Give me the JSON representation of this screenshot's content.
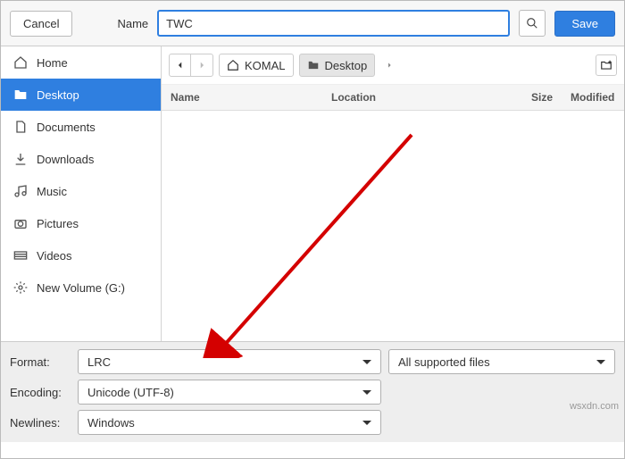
{
  "toolbar": {
    "cancel_label": "Cancel",
    "name_label": "Name",
    "name_value": "TWC",
    "save_label": "Save"
  },
  "sidebar": {
    "items": [
      {
        "label": "Home",
        "icon": "home-icon"
      },
      {
        "label": "Desktop",
        "icon": "folder-icon",
        "active": true
      },
      {
        "label": "Documents",
        "icon": "document-icon"
      },
      {
        "label": "Downloads",
        "icon": "download-icon"
      },
      {
        "label": "Music",
        "icon": "music-icon"
      },
      {
        "label": "Pictures",
        "icon": "camera-icon"
      },
      {
        "label": "Videos",
        "icon": "video-icon"
      },
      {
        "label": "New Volume (G:)",
        "icon": "gear-icon"
      }
    ]
  },
  "breadcrumb": {
    "parts": [
      {
        "label": "KOMAL",
        "icon": "home-icon"
      },
      {
        "label": "Desktop",
        "icon": "folder-icon",
        "active": true
      }
    ]
  },
  "columns": {
    "name": "Name",
    "location": "Location",
    "size": "Size",
    "modified": "Modified"
  },
  "bottom": {
    "format_label": "Format:",
    "format_value": "LRC",
    "filter_value": "All supported files",
    "encoding_label": "Encoding:",
    "encoding_value": "Unicode (UTF-8)",
    "newlines_label": "Newlines:",
    "newlines_value": "Windows"
  },
  "watermark": "wsxdn.com"
}
